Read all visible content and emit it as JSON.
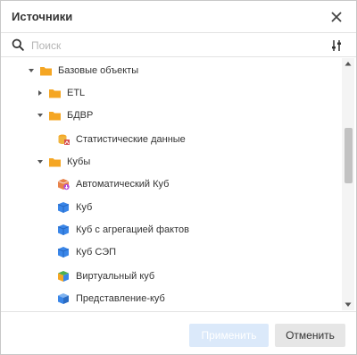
{
  "dialog": {
    "title": "Источники",
    "close_icon": "close-icon"
  },
  "search": {
    "placeholder": "Поиск",
    "value": "",
    "icon": "search-icon",
    "filter_icon": "filter-settings-icon"
  },
  "tree": {
    "items": [
      {
        "label": "Базовые объекты",
        "level": 0,
        "caret": "expanded",
        "icon": "folder-icon"
      },
      {
        "label": "ETL",
        "level": 1,
        "caret": "collapsed",
        "icon": "folder-icon"
      },
      {
        "label": "БДВР",
        "level": 1,
        "caret": "expanded",
        "icon": "folder-icon"
      },
      {
        "label": "Статистические данные",
        "level": 2,
        "caret": "none",
        "icon": "statistical-data-icon"
      },
      {
        "label": "Кубы",
        "level": 1,
        "caret": "expanded",
        "icon": "folder-icon"
      },
      {
        "label": "Автоматический Куб",
        "level": 2,
        "caret": "none",
        "icon": "automatic-cube-icon"
      },
      {
        "label": "Куб",
        "level": 2,
        "caret": "none",
        "icon": "cube-icon"
      },
      {
        "label": "Куб с агрегацией фактов",
        "level": 2,
        "caret": "none",
        "icon": "cube-icon"
      },
      {
        "label": "Куб СЭП",
        "level": 2,
        "caret": "none",
        "icon": "cube-icon"
      },
      {
        "label": "Виртуальный куб",
        "level": 2,
        "caret": "none",
        "icon": "virtual-cube-icon"
      },
      {
        "label": "Представление-куб",
        "level": 2,
        "caret": "none",
        "icon": "view-cube-icon"
      }
    ]
  },
  "footer": {
    "apply_label": "Применить",
    "cancel_label": "Отменить"
  },
  "colors": {
    "folder": "#f5a623",
    "cube": "#3a86e8",
    "apply_disabled_bg": "#dbe9fa",
    "cancel_bg": "#e6e6e6"
  }
}
